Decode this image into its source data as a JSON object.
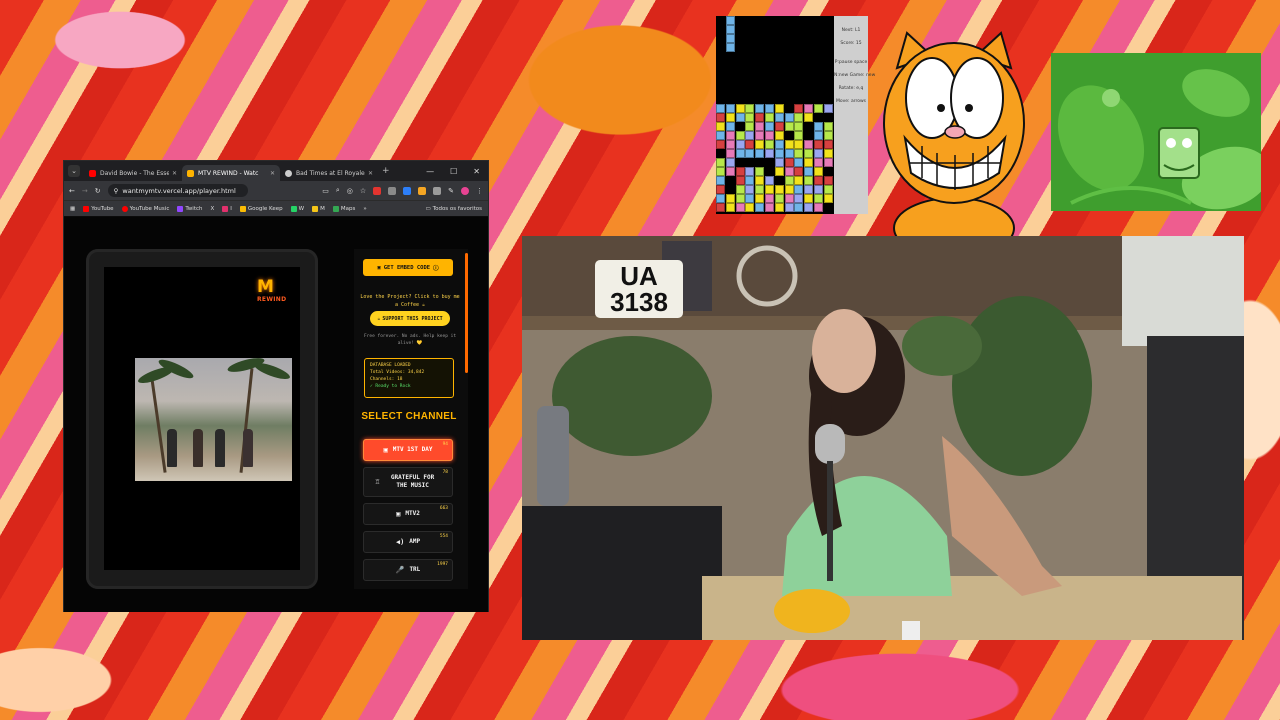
{
  "browser": {
    "tabs": [
      {
        "label": "David Bowie - The Essenti",
        "color": "#ff0000",
        "active": false
      },
      {
        "label": "MTV REWIND - Watc",
        "color": "#ffb400",
        "active": true
      },
      {
        "label": "Bad Times at El Royale - ",
        "color": "#cccccc",
        "active": false
      }
    ],
    "new_tab": "+",
    "url": "wantmymtv.vercel.app/player.html",
    "bookmarks": [
      "YouTube",
      "YouTube Music",
      "Twitch",
      "X",
      "I",
      "Google Keep",
      "W",
      "M",
      "Maps"
    ],
    "bookmarks_more": "»",
    "all_bookmarks": "Todos os favoritos"
  },
  "player": {
    "logo_main": "M",
    "logo_sub": "REWIND",
    "embed_label": "GET EMBED CODE",
    "love_text": "Love the Project? Click to buy me a Coffee ☕",
    "support_label": "SUPPORT THIS PROJECT",
    "note_text": "Free forever. No ads. Help keep it alive! 💛",
    "db_title": "DATABASE LOADED",
    "db_videos": "Total Videos: 34,842",
    "db_channels": "Channels: 18",
    "db_status": "✓ Ready to Rock",
    "select_title": "SELECT CHANNEL",
    "channels": [
      {
        "name": "MTV 1ST DAY",
        "count": "94",
        "icon": "▣",
        "active": true
      },
      {
        "name": "GRATEFUL FOR THE MUSIC",
        "count": "78",
        "icon": "♖",
        "active": false
      },
      {
        "name": "MTV2",
        "count": "663",
        "icon": "▣",
        "active": false
      },
      {
        "name": "AMP",
        "count": "554",
        "icon": "◀)",
        "active": false
      },
      {
        "name": "TRL",
        "count": "1997",
        "icon": "🎤",
        "active": false
      }
    ]
  },
  "tetris": {
    "next": "Next: L1",
    "score": "Score: 15",
    "pause": "P:pause space",
    "new_game": "N:new Game: new",
    "rotate": "Rotate: e,q",
    "move": "Move: arrows"
  },
  "webcam": {
    "plate_line1": "UA",
    "plate_line2": "3138"
  }
}
